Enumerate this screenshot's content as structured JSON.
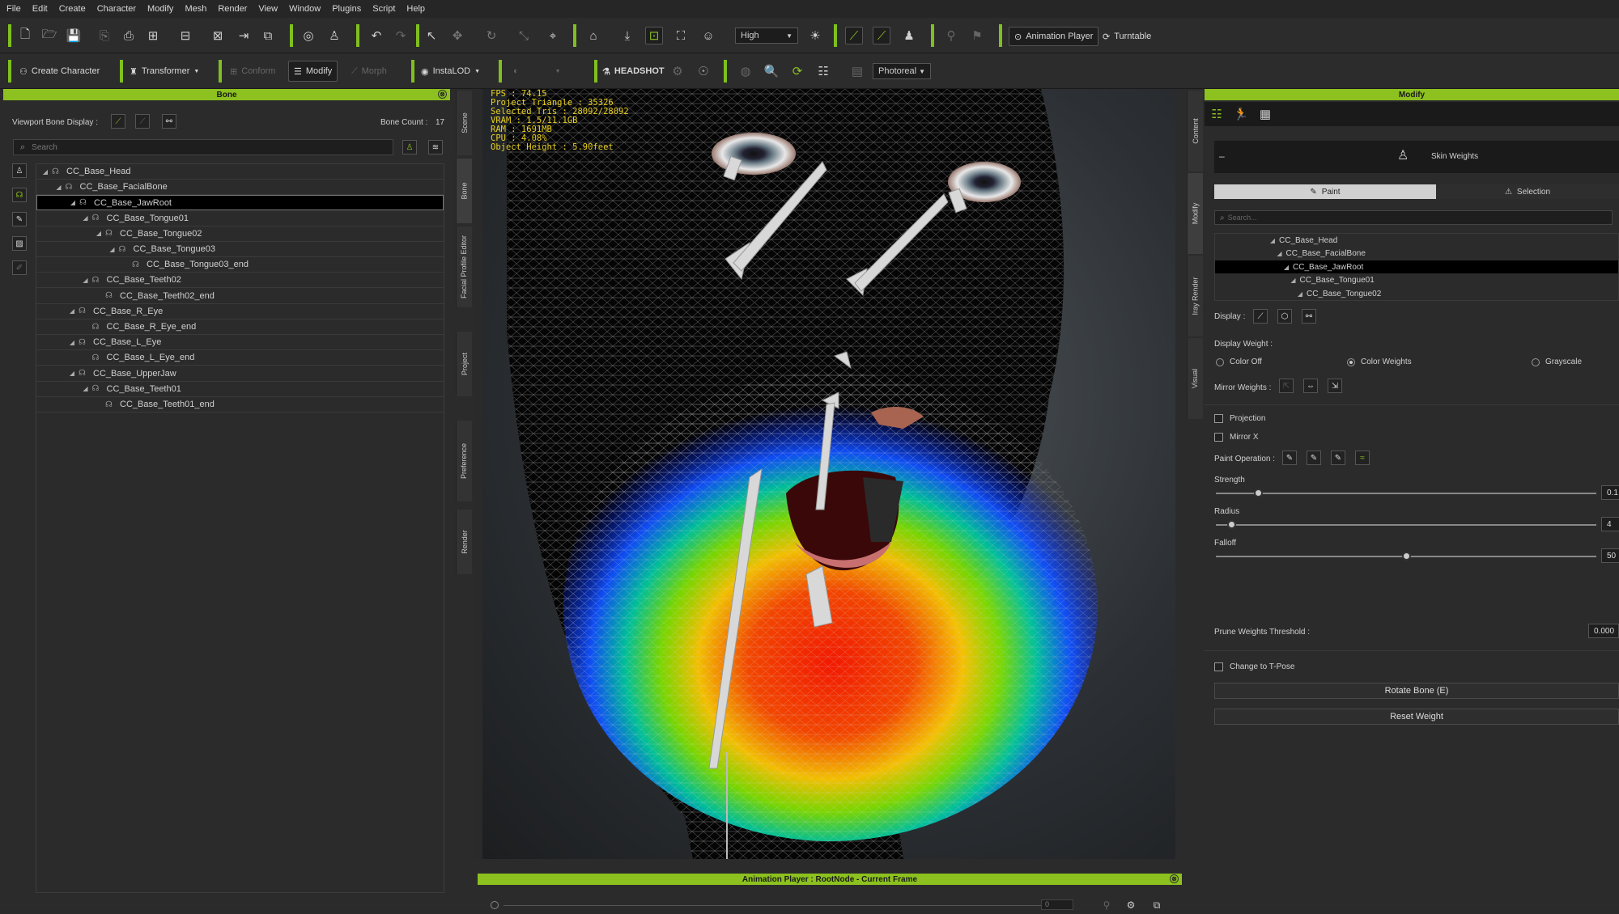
{
  "menu": [
    "File",
    "Edit",
    "Create",
    "Character",
    "Modify",
    "Mesh",
    "Render",
    "View",
    "Window",
    "Plugins",
    "Script",
    "Help"
  ],
  "toolbar1": {
    "quality": "High",
    "animation_player": "Animation Player",
    "turntable": "Turntable"
  },
  "toolbar2": {
    "create_character": "Create Character",
    "transformer": "Transformer",
    "conform": "Conform",
    "modify": "Modify",
    "morph": "Morph",
    "instalod": "InstaLOD",
    "headshot": "HEADSHOT",
    "render_mode": "Photoreal"
  },
  "bone_panel": {
    "title": "Bone",
    "viewport_bone_display": "Viewport Bone Display :",
    "bone_count_label": "Bone Count :",
    "bone_count": "17",
    "search_placeholder": "Search",
    "tree": [
      {
        "label": "CC_Base_Head",
        "depth": 0,
        "arrow": true
      },
      {
        "label": "CC_Base_FacialBone",
        "depth": 1,
        "arrow": true
      },
      {
        "label": "CC_Base_JawRoot",
        "depth": 2,
        "arrow": true,
        "selected": true
      },
      {
        "label": "CC_Base_Tongue01",
        "depth": 3,
        "arrow": true
      },
      {
        "label": "CC_Base_Tongue02",
        "depth": 4,
        "arrow": true
      },
      {
        "label": "CC_Base_Tongue03",
        "depth": 5,
        "arrow": true
      },
      {
        "label": "CC_Base_Tongue03_end",
        "depth": 6,
        "arrow": false
      },
      {
        "label": "CC_Base_Teeth02",
        "depth": 3,
        "arrow": true
      },
      {
        "label": "CC_Base_Teeth02_end",
        "depth": 4,
        "arrow": false
      },
      {
        "label": "CC_Base_R_Eye",
        "depth": 2,
        "arrow": true
      },
      {
        "label": "CC_Base_R_Eye_end",
        "depth": 3,
        "arrow": false
      },
      {
        "label": "CC_Base_L_Eye",
        "depth": 2,
        "arrow": true
      },
      {
        "label": "CC_Base_L_Eye_end",
        "depth": 3,
        "arrow": false
      },
      {
        "label": "CC_Base_UpperJaw",
        "depth": 2,
        "arrow": true
      },
      {
        "label": "CC_Base_Teeth01",
        "depth": 3,
        "arrow": true
      },
      {
        "label": "CC_Base_Teeth01_end",
        "depth": 4,
        "arrow": false
      }
    ]
  },
  "left_vtabs": [
    "Scene",
    "Bone",
    "Facial Profile Editor",
    "Project",
    "Preference",
    "Render"
  ],
  "right_vtabs": [
    "Content",
    "Modify",
    "Iray Render",
    "Visual"
  ],
  "viewport": {
    "hud": [
      "FPS : 74.15",
      "Project Triangle : 35326",
      "Selected Tris : 28092/28092",
      "VRAM : 1.5/11.1GB",
      "RAM : 1691MB",
      "CPU : 4.08%",
      "Object Height : 5.90feet"
    ]
  },
  "anim_player": {
    "title": "Animation Player : RootNode - Current Frame",
    "frame": "0"
  },
  "modify_panel": {
    "title": "Modify",
    "skin_weights": "Skin Weights",
    "tab_paint": "Paint",
    "tab_selection": "Selection",
    "search_placeholder": "Search...",
    "tree": [
      {
        "label": "CC_Base_Head",
        "depth": 0
      },
      {
        "label": "CC_Base_FacialBone",
        "depth": 1
      },
      {
        "label": "CC_Base_JawRoot",
        "depth": 2,
        "selected": true
      },
      {
        "label": "CC_Base_Tongue01",
        "depth": 3
      },
      {
        "label": "CC_Base_Tongue02",
        "depth": 4
      }
    ],
    "display_label": "Display :",
    "display_weight_label": "Display Weight :",
    "radio_color_off": "Color Off",
    "radio_color_weights": "Color Weights",
    "radio_grayscale": "Grayscale",
    "mirror_weights_label": "Mirror Weights :",
    "projection": "Projection",
    "mirror_x": "Mirror X",
    "paint_operation_label": "Paint Operation :",
    "strength_label": "Strength",
    "strength_value": "0.1",
    "strength_level": 0.11,
    "radius_label": "Radius",
    "radius_value": "4",
    "radius_level": 0.04,
    "falloff_label": "Falloff",
    "falloff_value": "50",
    "falloff_level": 0.5,
    "prune_label": "Prune Weights Threshold :",
    "prune_value": "0.000",
    "tpose": "Change to T-Pose",
    "rotate_bone": "Rotate Bone (E)",
    "reset_weight": "Reset Weight"
  },
  "colors": {
    "accent": "#8cc11f",
    "panel_bg": "#2b2b2b",
    "hud_text": "#e8d020"
  }
}
